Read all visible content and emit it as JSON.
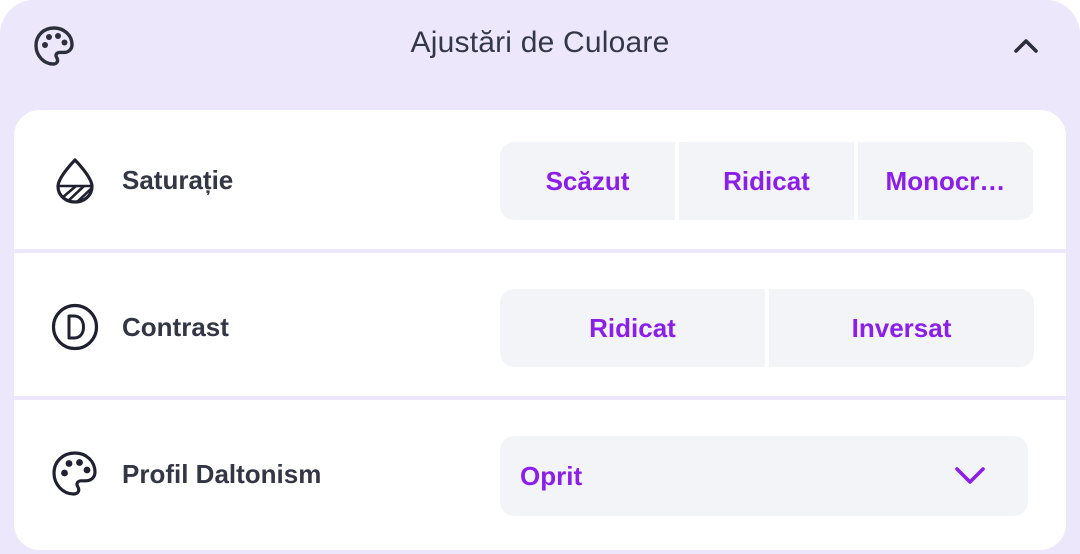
{
  "header": {
    "title": "Ajustări de Culoare",
    "icon": "palette-icon",
    "collapse_icon": "chevron-up-icon"
  },
  "colors": {
    "accent": "#8b1ee8",
    "panel_bg": "#ede7fc",
    "option_bg": "#f3f4f7",
    "text": "#333645"
  },
  "rows": [
    {
      "label": "Saturație",
      "icon": "droplet-icon",
      "options": [
        "Scăzut",
        "Ridicat",
        "Monocr…"
      ]
    },
    {
      "label": "Contrast",
      "icon": "contrast-icon",
      "options": [
        "Ridicat",
        "Inversat"
      ]
    },
    {
      "label": "Profil Daltonism",
      "icon": "palette-icon",
      "select": {
        "value": "Oprit",
        "icon": "chevron-down-icon"
      }
    }
  ]
}
